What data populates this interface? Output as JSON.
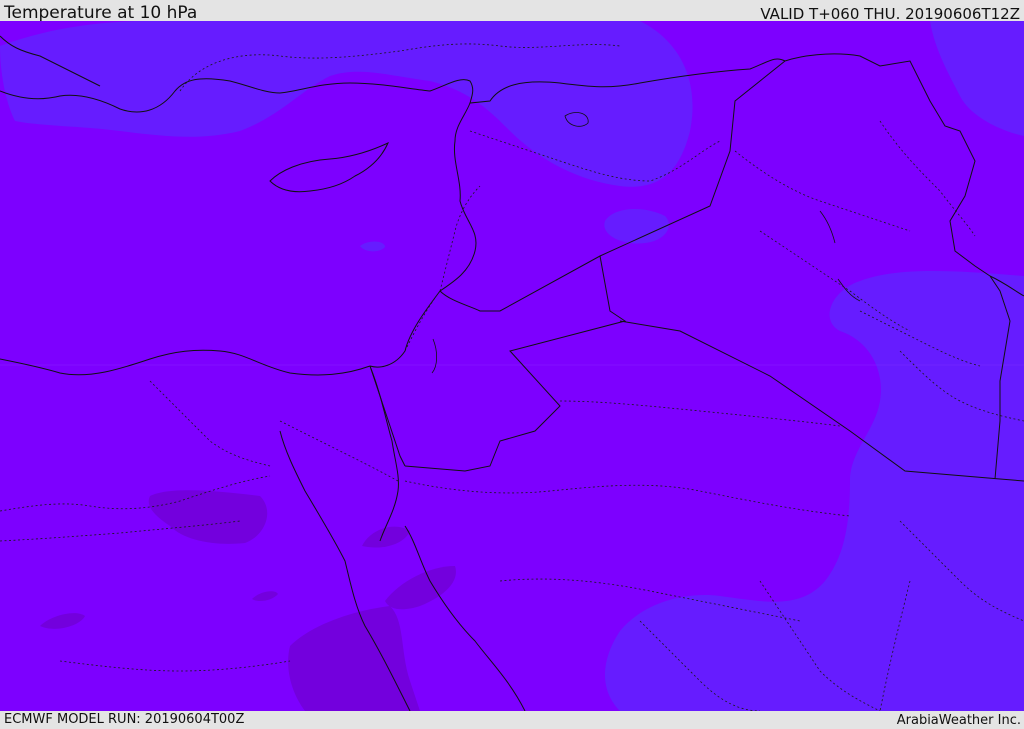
{
  "header": {
    "title": "Temperature at 10 hPa",
    "valid": "VALID T+060 THU. 20190606T12Z"
  },
  "footer": {
    "model_run": "ECMWF MODEL RUN: 20190604T00Z",
    "credit": "ArabiaWeather Inc."
  },
  "map": {
    "colors": {
      "base_field": "#7d00ff",
      "cool_field": "#661cff",
      "warm_field": "#7300dd",
      "coastline": "#111111",
      "border": "#111111"
    }
  }
}
